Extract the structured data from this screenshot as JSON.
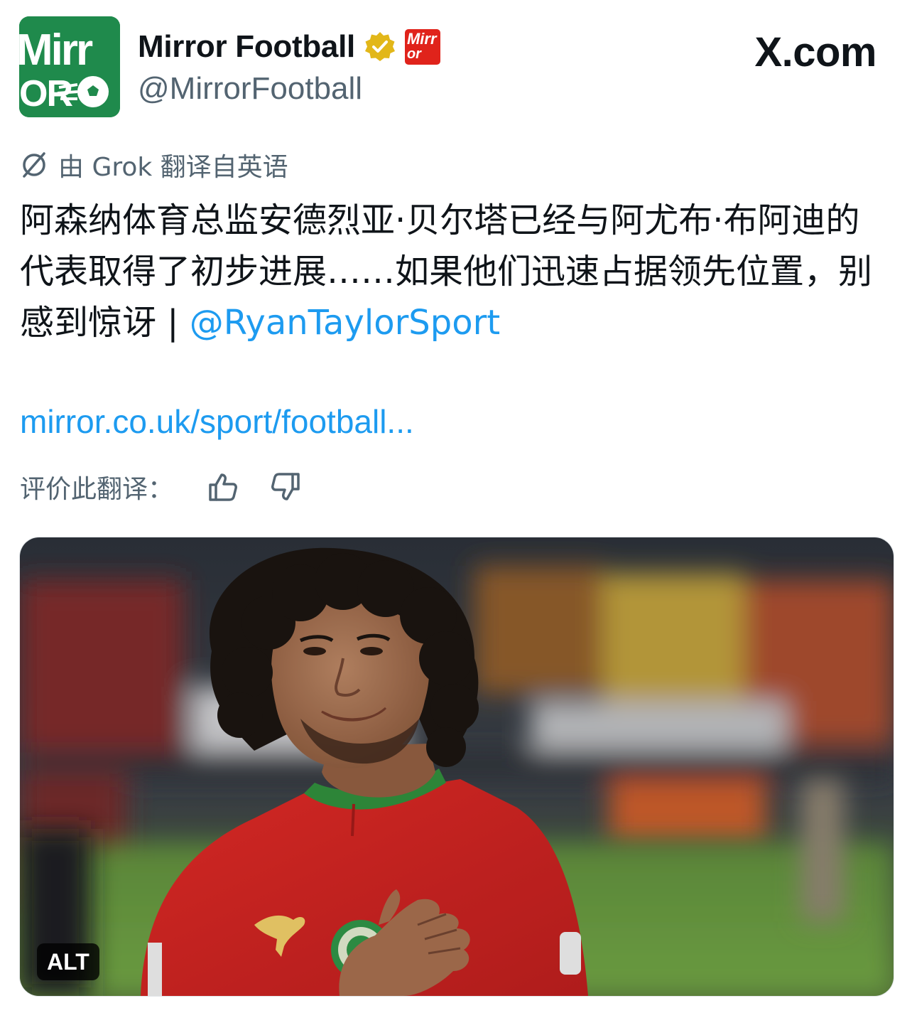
{
  "account": {
    "display_name": "Mirror Football",
    "handle": "@MirrorFootball",
    "avatar_text_top": "Mirr",
    "avatar_text_bottom": "OR",
    "affiliate_text_top": "Mirr",
    "affiliate_text_bottom": "or",
    "verified": "gold-verified-badge-icon"
  },
  "site_label": "X.com",
  "translation": {
    "notice": "由 Grok 翻译自英语",
    "icon": "translate-icon"
  },
  "tweet": {
    "text": "阿森纳体育总监安德烈亚·贝尔塔已经与阿尤布·布阿迪的代表取得了初步进展……如果他们迅速占据领先位置，别感到惊讶 | ",
    "mention": "@RyanTaylorSport",
    "link": "mirror.co.uk/sport/football..."
  },
  "rating": {
    "label": "评价此翻译：",
    "thumbs_up": "thumbs-up-icon",
    "thumbs_down": "thumbs-down-icon"
  },
  "media": {
    "alt_label": "ALT",
    "kit_brand": "puma-logo"
  },
  "colors": {
    "brand_green": "#1f8a4c",
    "mirror_red": "#e0231b",
    "link_blue": "#1d9bf0",
    "secondary_text": "#536471",
    "gold_badge": "#e2b719"
  }
}
